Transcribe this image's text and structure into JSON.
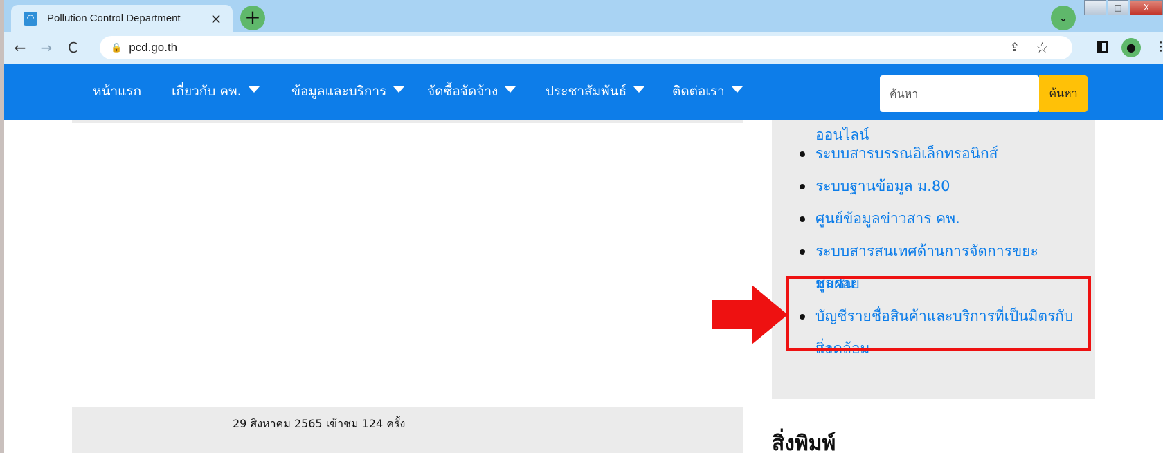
{
  "browser": {
    "tab_title": "Pollution Control Department",
    "tab_close": "×",
    "new_tab": "+",
    "tab_search": "⌄",
    "url": "pcd.go.th",
    "window": {
      "minimize": "–",
      "maximize": "□",
      "close": "X"
    }
  },
  "toolbar": {
    "back": "←",
    "forward": "→",
    "reload": "C",
    "lock": "🔒",
    "share": "⇪",
    "star": "☆",
    "menu": "⋮"
  },
  "site_nav": {
    "items": [
      {
        "label": "หน้าแรก",
        "dropdown": false
      },
      {
        "label": "เกี่ยวกับ คพ.",
        "dropdown": true
      },
      {
        "label": "ข้อมูลและบริการ",
        "dropdown": true
      },
      {
        "label": "จัดซื้อจัดจ้าง",
        "dropdown": true
      },
      {
        "label": "ประชาสัมพันธ์",
        "dropdown": true
      },
      {
        "label": "ติดต่อเรา",
        "dropdown": true
      }
    ],
    "search_placeholder": "ค้นหา",
    "search_button": "ค้นหา"
  },
  "sidebar": {
    "continued_text": "ออนไลน์",
    "links": [
      {
        "lines": [
          "ระบบสารบรรณอิเล็กทรอนิกส์"
        ]
      },
      {
        "lines": [
          "ระบบฐานข้อมูล ม.80"
        ]
      },
      {
        "lines": [
          "ศูนย์ข้อมูลข่าวสาร คพ."
        ]
      },
      {
        "lines": [
          "ระบบสารสนเทศด้านการจัดการขยะมูลฝอย",
          "ชุมชน"
        ]
      },
      {
        "lines": [
          "บัญชีรายชื่อสินค้าและบริการที่เป็นมิตรกับสิ่ง",
          "แวดล้อม"
        ]
      }
    ]
  },
  "footer": {
    "visit_text": "29 สิงหาคม 2565 เข้าชม 124 ครั้ง"
  },
  "section_heading": "สิ่งพิมพ์",
  "colors": {
    "nav_blue": "#0d7de9",
    "search_yellow": "#ffc107",
    "highlight_red": "#ee1111"
  }
}
